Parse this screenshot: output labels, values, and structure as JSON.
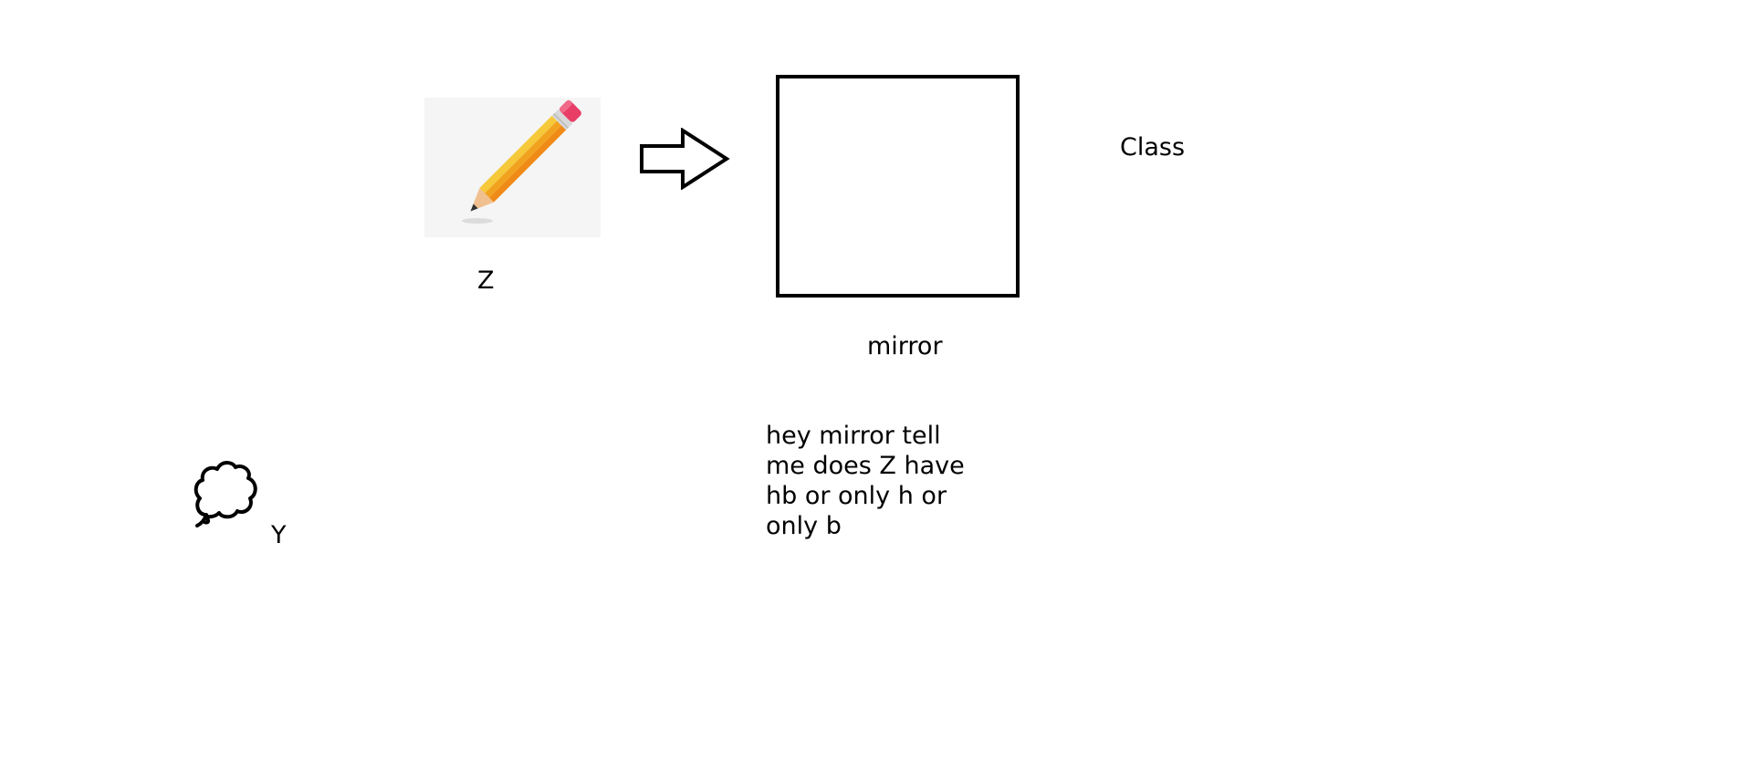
{
  "labels": {
    "z": "Z",
    "mirror": "mirror",
    "class": "Class",
    "y": "Y"
  },
  "question": "hey mirror tell\nme does Z have\nhb or only h or\nonly b",
  "icons": {
    "pencil": "pencil-icon",
    "arrow": "right-arrow-icon",
    "cloud": "thought-cloud-icon"
  },
  "colors": {
    "pencil_body": "#f2a21e",
    "pencil_eraser": "#e83e66",
    "card_background": "#f5f5f5"
  }
}
